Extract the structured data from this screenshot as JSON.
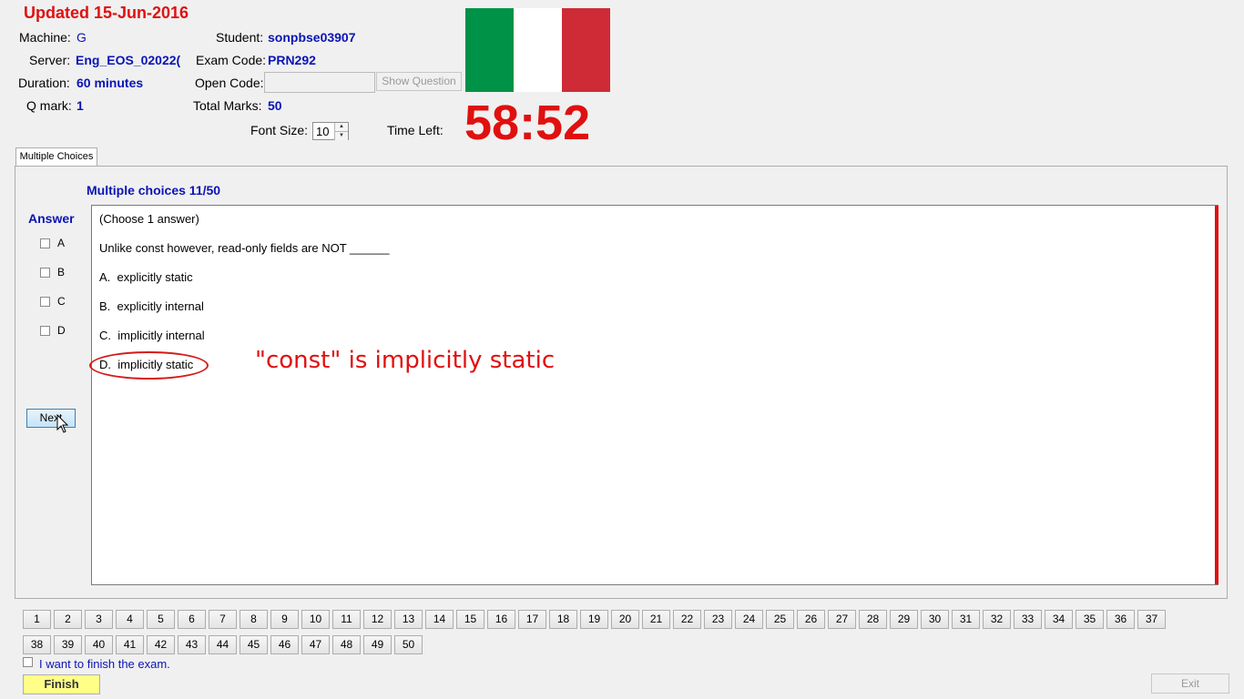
{
  "header": {
    "updated": "Updated 15-Jun-2016",
    "machine_label": "Machine:",
    "machine": "G",
    "server_label": "Server:",
    "server": "Eng_EOS_02022(",
    "duration_label": "Duration:",
    "duration": "60 minutes",
    "qmark_label": "Q mark:",
    "qmark": "1",
    "student_label": "Student:",
    "student": "sonpbse03907",
    "exam_code_label": "Exam Code:",
    "exam_code": "PRN292",
    "open_code_label": "Open Code:",
    "open_code_value": "",
    "show_question": "Show Question",
    "total_marks_label": "Total Marks:",
    "total_marks": "50",
    "font_size_label": "Font Size:",
    "font_size": "10",
    "time_left_label": "Time Left:",
    "time_left": "58:52",
    "flag_colors": [
      "#009246",
      "#ffffff",
      "#ce2b37"
    ]
  },
  "tab": {
    "label": "Multiple Choices"
  },
  "question": {
    "title": "Multiple choices 11/50",
    "instruction": "(Choose 1 answer)",
    "text": "Unlike const however, read-only fields are NOT ______",
    "options": [
      {
        "letter": "A.",
        "text": "explicitly static"
      },
      {
        "letter": "B.",
        "text": "explicitly internal"
      },
      {
        "letter": "C.",
        "text": "implicitly internal"
      },
      {
        "letter": "D.",
        "text": "implicitly static"
      }
    ]
  },
  "answer": {
    "label": "Answer",
    "choices": [
      "A",
      "B",
      "C",
      "D"
    ],
    "next": "Next"
  },
  "annotation": {
    "text": "\"const\" is implicitly static",
    "color": "#e01010"
  },
  "question_nav": {
    "row1": [
      "1",
      "2",
      "3",
      "4",
      "5",
      "6",
      "7",
      "8",
      "9",
      "10",
      "11",
      "12",
      "13",
      "14",
      "15",
      "16",
      "17",
      "18",
      "19",
      "20",
      "21",
      "22",
      "23",
      "24",
      "25",
      "26",
      "27",
      "28",
      "29",
      "30",
      "31",
      "32",
      "33",
      "34",
      "35",
      "36",
      "37"
    ],
    "row2": [
      "38",
      "39",
      "40",
      "41",
      "42",
      "43",
      "44",
      "45",
      "46",
      "47",
      "48",
      "49",
      "50"
    ]
  },
  "footer": {
    "finish_check_label": "I want to finish the exam.",
    "finish": "Finish",
    "exit": "Exit"
  }
}
